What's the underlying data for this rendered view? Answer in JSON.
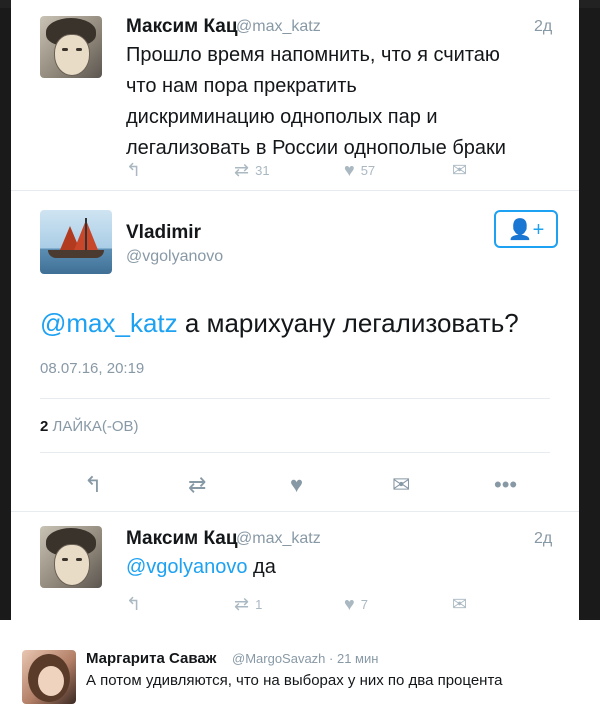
{
  "tweet1": {
    "name": "Максим Кац",
    "handle": "@max_katz",
    "age": "2д",
    "lines": [
      "Прошло время напомнить, что я считаю",
      "что нам пора прекратить",
      "дискриминацию однополых пар и",
      "легализовать в России однополые браки"
    ],
    "retweets": "31",
    "likes": "57"
  },
  "tweet2": {
    "name": "Vladimir",
    "handle": "@vgolyanovo",
    "mention": "@max_katz",
    "text": "а марихуану легализовать?",
    "date": "08.07.16, 20:19",
    "likes_count": "2",
    "likes_label": "ЛАЙКА(-ОВ)"
  },
  "tweet3": {
    "name": "Максим Кац",
    "handle": "@max_katz",
    "age": "2д",
    "mention": "@vgolyanovo",
    "text": "да",
    "retweets": "1",
    "likes": "7"
  },
  "footer": {
    "name": "Маргарита Саваж",
    "handle": "@MargoSavazh",
    "age": "21 мин",
    "text": "А потом удивляются, что на выборах у них по два процента"
  },
  "icons": {
    "reply": "reply-icon",
    "retweet": "retweet-icon",
    "like": "heart-icon",
    "dm": "envelope-icon",
    "more": "more-icon",
    "follow": "follow-icon"
  },
  "colors": {
    "accent": "#1da1f2",
    "muted": "#8899a6"
  }
}
